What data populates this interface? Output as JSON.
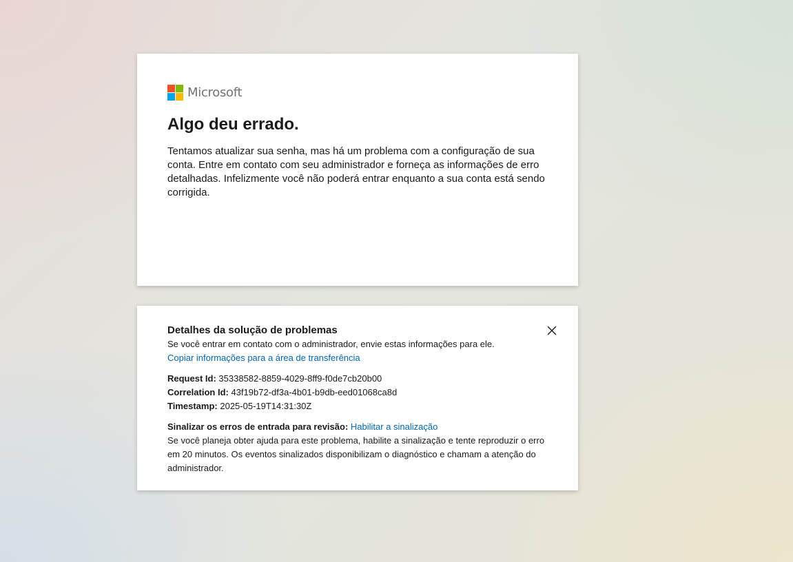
{
  "brand": {
    "name": "Microsoft",
    "colors": {
      "red": "#f25022",
      "green": "#7fba00",
      "blue": "#00a4ef",
      "yellow": "#ffb900",
      "link": "#0067b8"
    }
  },
  "error": {
    "title": "Algo deu errado.",
    "description": "Tentamos atualizar sua senha, mas há um problema com a configuração de sua conta. Entre em contato com seu administrador e forneça as informações de erro detalhadas. Infelizmente você não poderá entrar enquanto a sua conta está sendo corrigida."
  },
  "details": {
    "title": "Detalhes da solução de problemas",
    "subtitle": "Se você entrar em contato com o administrador, envie estas informações para ele.",
    "copy_link": "Copiar informações para a área de transferência",
    "close_icon": "close-icon",
    "request_id_label": "Request Id:",
    "request_id": "35338582-8859-4029-8ff9-f0de7cb20b00",
    "correlation_id_label": "Correlation Id:",
    "correlation_id": "43f19b72-df3a-4b01-b9db-eed01068ca8d",
    "timestamp_label": "Timestamp:",
    "timestamp": "2025-05-19T14:31:30Z",
    "flag_label": "Sinalizar os erros de entrada para revisão:",
    "flag_link": "Habilitar a sinalização",
    "flag_description": "Se você planeja obter ajuda para este problema, habilite a sinalização e tente reproduzir o erro em 20 minutos. Os eventos sinalizados disponibilizam o diagnóstico e chamam a atenção do administrador."
  }
}
